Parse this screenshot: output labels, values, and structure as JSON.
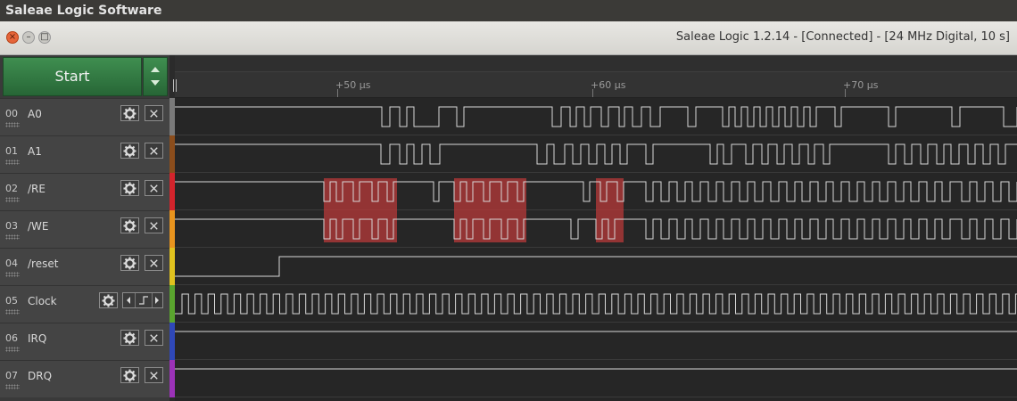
{
  "os_title": "Saleae Logic Software",
  "window": {
    "title": "Saleae Logic 1.2.14 - [Connected] - [24 MHz Digital, 10 s]",
    "close_glyph": "×",
    "min_glyph": "–",
    "max_glyph": "□"
  },
  "toolbar": {
    "start_label": "Start",
    "menu_icon": "up-down-arrows-icon"
  },
  "ruler": {
    "ticks": [
      {
        "label": "+50 µs"
      },
      {
        "label": "+60 µs"
      },
      {
        "label": "+70 µs"
      }
    ]
  },
  "channels": [
    {
      "num": "00",
      "name": "A0",
      "color": "#7a7a7a"
    },
    {
      "num": "01",
      "name": "A1",
      "color": "#8b4d1c"
    },
    {
      "num": "02",
      "name": "/RE",
      "color": "#d3242c"
    },
    {
      "num": "03",
      "name": "/WE",
      "color": "#e8941e"
    },
    {
      "num": "04",
      "name": "/reset",
      "color": "#e0c21e"
    },
    {
      "num": "05",
      "name": "Clock",
      "color": "#5aa52e"
    },
    {
      "num": "06",
      "name": "IRQ",
      "color": "#2f48b8"
    },
    {
      "num": "07",
      "name": "DRQ",
      "color": "#9b32b8"
    }
  ],
  "colors": {
    "trace": "#d8d8d8",
    "highlight": "#b83a3a"
  }
}
